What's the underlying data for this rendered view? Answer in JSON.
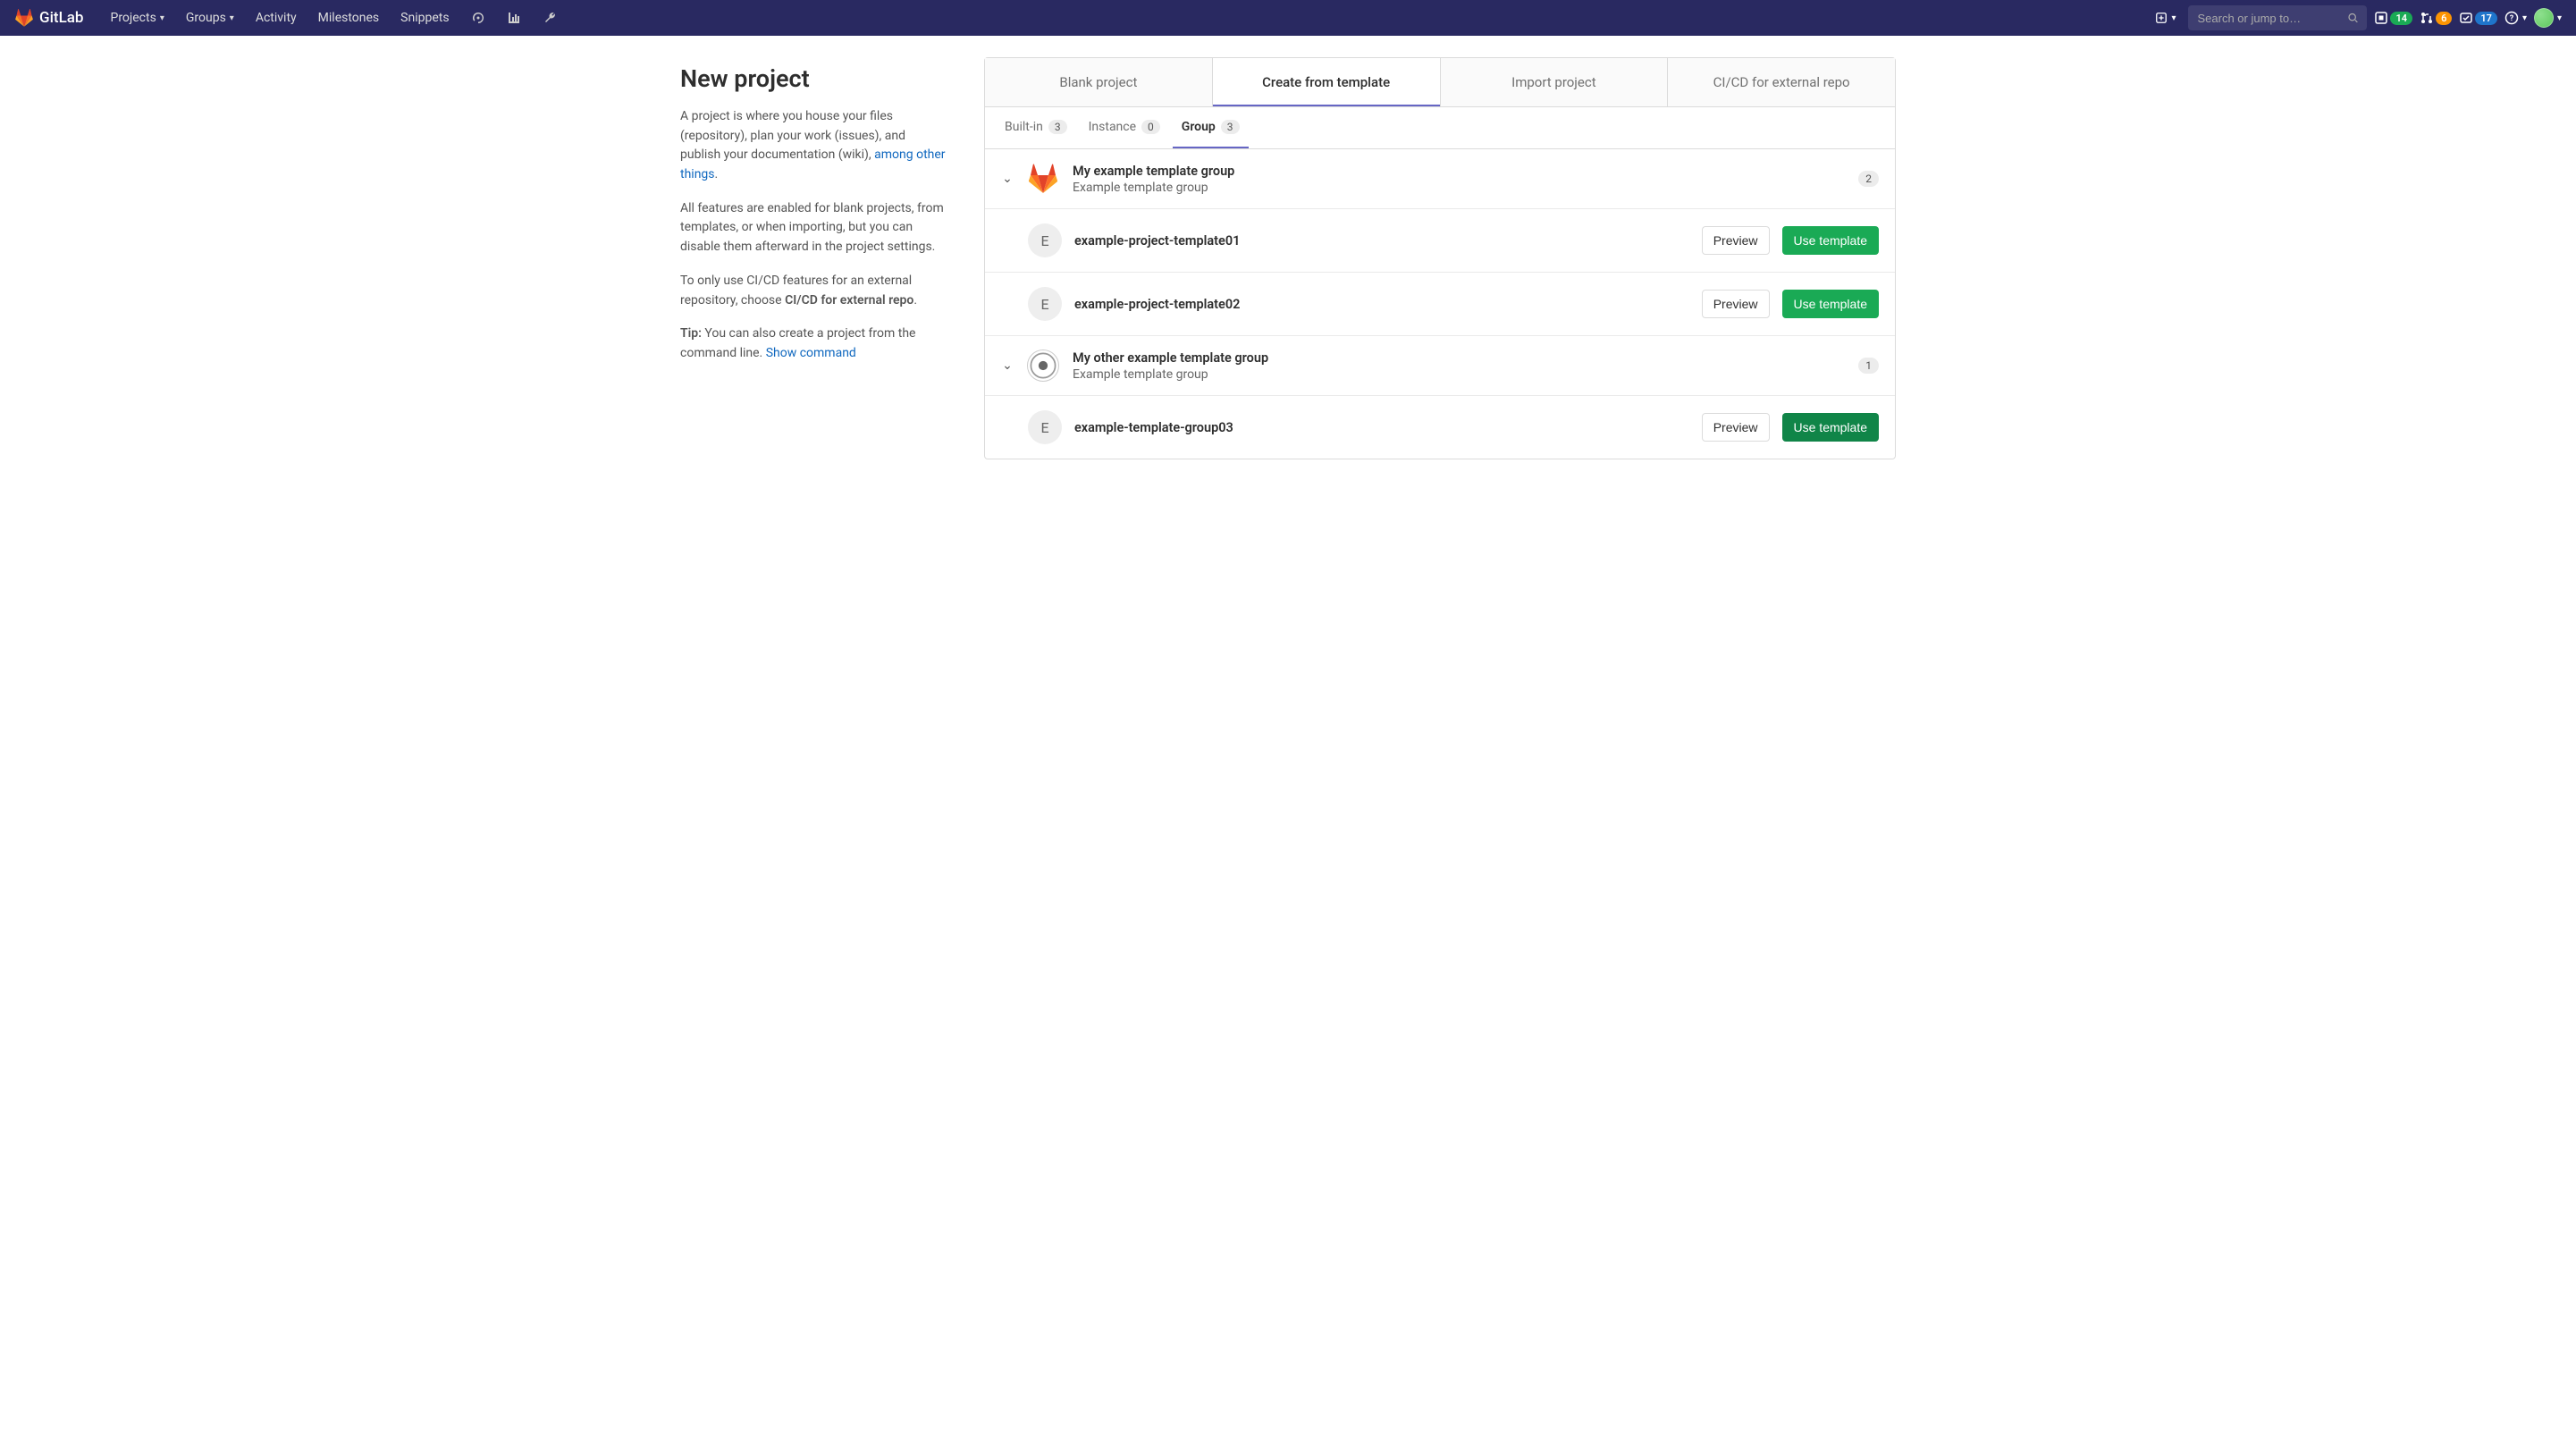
{
  "navbar": {
    "brand": "GitLab",
    "items": [
      "Projects",
      "Groups",
      "Activity",
      "Milestones",
      "Snippets"
    ],
    "search_placeholder": "Search or jump to…",
    "issues_count": "14",
    "mr_count": "6",
    "todo_count": "17"
  },
  "page": {
    "title": "New project",
    "para1_a": "A project is where you house your files (repository), plan your work (issues), and publish your documentation (wiki), ",
    "para1_link": "among other things",
    "para1_b": ".",
    "para2": "All features are enabled for blank projects, from templates, or when importing, but you can disable them afterward in the project settings.",
    "para3_a": "To only use CI/CD features for an external repository, choose ",
    "para3_bold": "CI/CD for external repo",
    "para3_b": ".",
    "para4_bold": "Tip:",
    "para4_a": " You can also create a project from the command line. ",
    "para4_link": "Show command"
  },
  "tabs": {
    "main": [
      "Blank project",
      "Create from template",
      "Import project",
      "CI/CD for external repo"
    ],
    "sub": [
      {
        "label": "Built-in",
        "count": "3"
      },
      {
        "label": "Instance",
        "count": "0"
      },
      {
        "label": "Group",
        "count": "3"
      }
    ]
  },
  "groups": [
    {
      "name": "My example template group",
      "desc": "Example template group",
      "count": "2",
      "icon": "gitlab",
      "templates": [
        {
          "letter": "E",
          "name": "example-project-template01"
        },
        {
          "letter": "E",
          "name": "example-project-template02"
        }
      ]
    },
    {
      "name": "My other example template group",
      "desc": "Example template group",
      "count": "1",
      "icon": "circle",
      "templates": [
        {
          "letter": "E",
          "name": "example-template-group03"
        }
      ]
    }
  ],
  "buttons": {
    "preview": "Preview",
    "use": "Use template"
  }
}
